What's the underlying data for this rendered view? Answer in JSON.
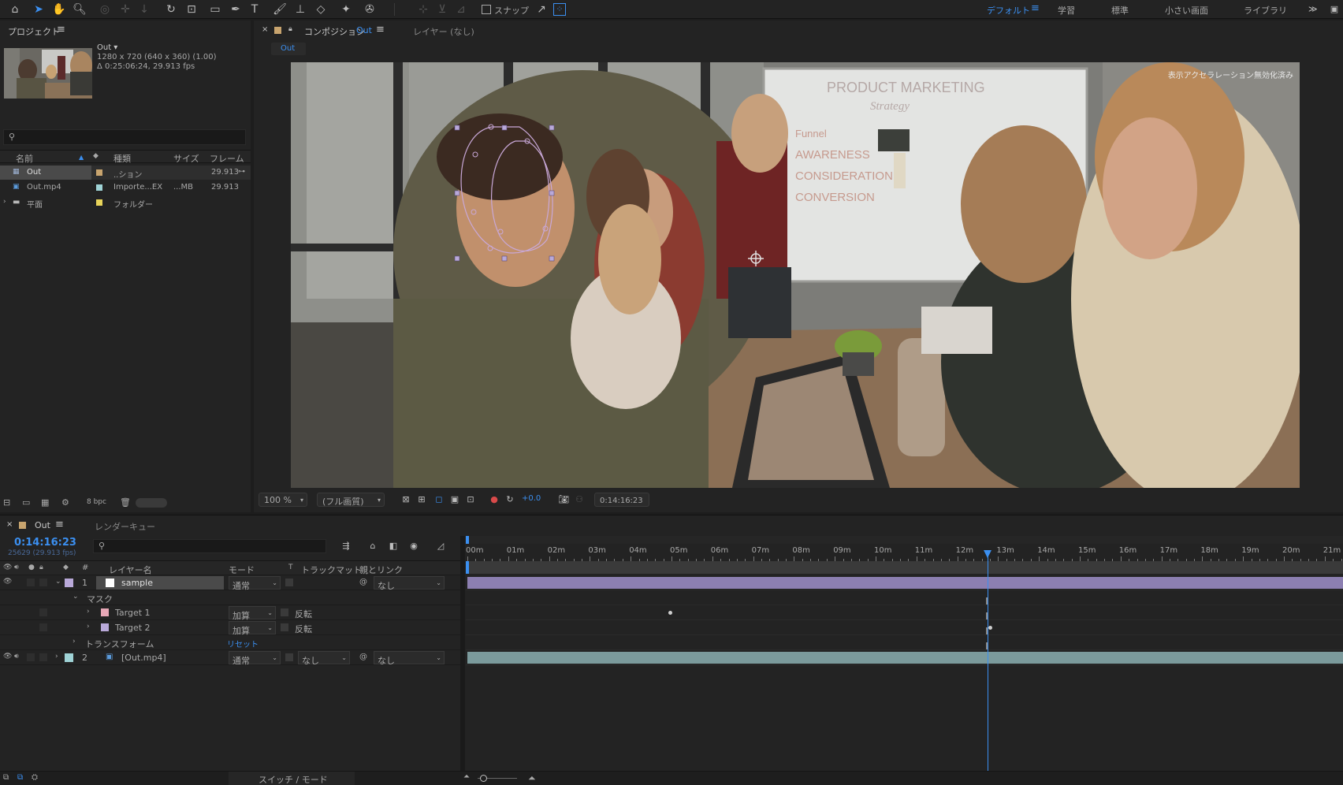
{
  "toolbar": {
    "snap_label": "スナップ",
    "workspaces": [
      "デフォルト",
      "学習",
      "標準",
      "小さい画面",
      "ライブラリ"
    ],
    "active_workspace": "デフォルト",
    "more": "≫"
  },
  "project": {
    "tab_label": "プロジェクト",
    "selected_name": "Out ▾",
    "selected_info_1": "1280 x 720  (640 x 360) (1.00)",
    "selected_info_2": "Δ 0:25:06:24, 29.913 fps",
    "columns": {
      "name": "名前",
      "type": "種類",
      "size": "サイズ",
      "frame": "フレームレ"
    },
    "items": [
      {
        "name": "Out",
        "type": "..ション",
        "size": "",
        "fps": "29.913",
        "color": "#c8a46e",
        "selected": true
      },
      {
        "name": "Out.mp4",
        "type": "Importe...EX",
        "size": "...MB",
        "fps": "29.913",
        "color": "#9fd3d6",
        "selected": false
      },
      {
        "name": "平面",
        "type": "フォルダー",
        "size": "",
        "fps": "",
        "color": "#e8d45a",
        "selected": false
      }
    ],
    "bpc": "8 bpc"
  },
  "comp": {
    "tab_label": "コンポジション",
    "tab_name": "Out",
    "layer_tab": "レイヤー (なし)",
    "sub_tab": "Out",
    "overlay_text": "表示アクセラレーション無効化済み",
    "zoom": "100 %",
    "quality": "(フル画質)",
    "exposure": "+0.0",
    "timecode": "0:14:16:23",
    "whiteboard_title": "PRODUCT MARKETING",
    "whiteboard_sub": "Strategy",
    "whiteboard_lines": [
      "Funnel",
      "AWARENESS",
      "CONSIDERATION",
      "CONVERSION"
    ]
  },
  "timeline": {
    "tab_label": "Out",
    "render_queue": "レンダーキュー",
    "current_time": "0:14:16:23",
    "frame_info": "25629 (29.913 fps)",
    "columns": {
      "num": "#",
      "layer_name": "レイヤー名",
      "mode": "モード",
      "t": "T",
      "trackmatte": "トラックマット",
      "parent": "親とリンク"
    },
    "layers": [
      {
        "num": "1",
        "name": "sample",
        "mode": "通常",
        "parent": "なし",
        "color": "#b9a9d9"
      },
      {
        "num": "2",
        "name": "[Out.mp4]",
        "mode": "通常",
        "trackmatte": "なし",
        "parent": "なし",
        "color": "#9fd3d6"
      }
    ],
    "mask_group": "マスク",
    "masks": [
      {
        "name": "Target 1",
        "mode": "加算",
        "invert": "反転",
        "color": "#e7a7b6"
      },
      {
        "name": "Target 2",
        "mode": "加算",
        "invert": "反転",
        "color": "#b9a9d9"
      }
    ],
    "transform": "トランスフォーム",
    "reset": "リセット",
    "ruler_labels": [
      "00m",
      "01m",
      "02m",
      "03m",
      "04m",
      "05m",
      "06m",
      "07m",
      "08m",
      "09m",
      "10m",
      "11m",
      "12m",
      "13m",
      "14m",
      "15m",
      "16m",
      "17m",
      "18m",
      "19m",
      "20m",
      "21m"
    ],
    "playhead_fraction": 0.595,
    "footer_label": "スイッチ / モード"
  }
}
